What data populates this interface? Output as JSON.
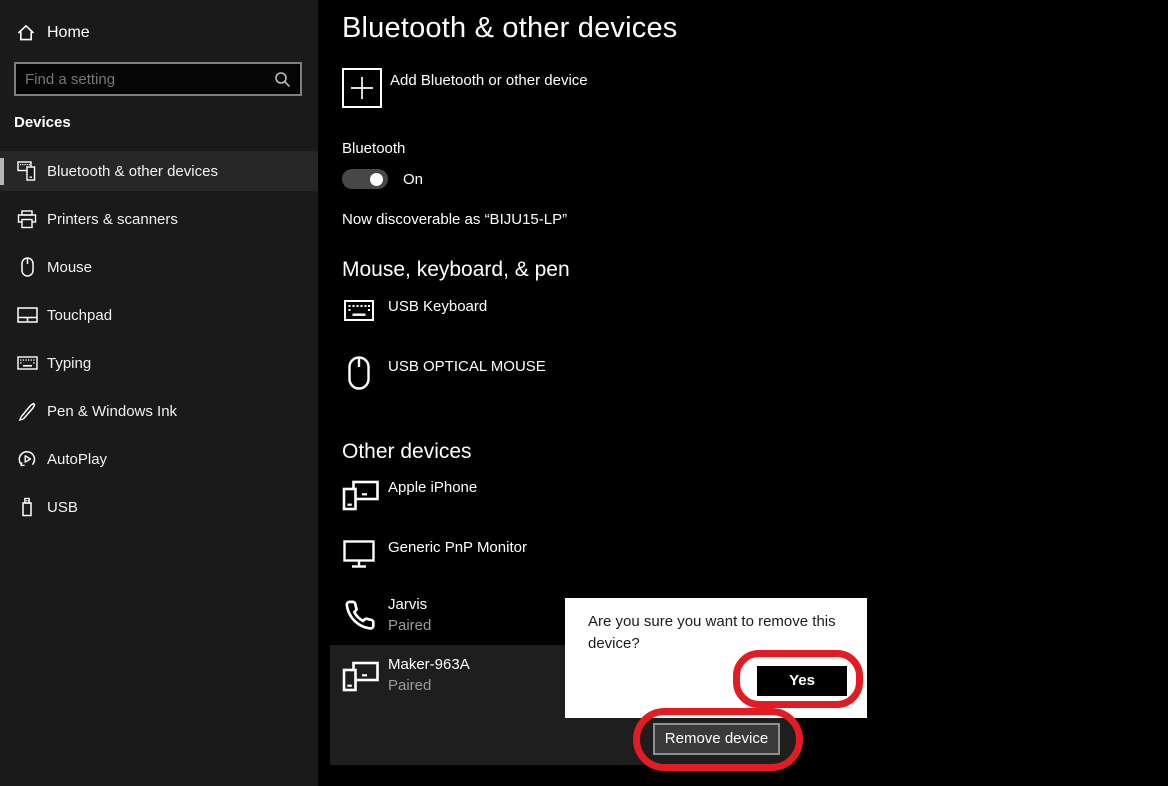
{
  "sidebar": {
    "home_label": "Home",
    "search_placeholder": "Find a setting",
    "section_label": "Devices",
    "items": [
      {
        "label": "Bluetooth & other devices",
        "selected": true
      },
      {
        "label": "Printers & scanners",
        "selected": false
      },
      {
        "label": "Mouse",
        "selected": false
      },
      {
        "label": "Touchpad",
        "selected": false
      },
      {
        "label": "Typing",
        "selected": false
      },
      {
        "label": "Pen & Windows Ink",
        "selected": false
      },
      {
        "label": "AutoPlay",
        "selected": false
      },
      {
        "label": "USB",
        "selected": false
      }
    ]
  },
  "main": {
    "title": "Bluetooth & other devices",
    "add_device_label": "Add Bluetooth or other device",
    "bluetooth": {
      "label": "Bluetooth",
      "state": "On"
    },
    "discoverable_text": "Now discoverable as “BIJU15-LP”",
    "sections": [
      {
        "header": "Mouse, keyboard, & pen",
        "devices": [
          {
            "name": "USB Keyboard"
          },
          {
            "name": "USB OPTICAL MOUSE"
          }
        ]
      },
      {
        "header": "Other devices",
        "devices": [
          {
            "name": "Apple iPhone"
          },
          {
            "name": "Generic PnP Monitor"
          },
          {
            "name": "Jarvis",
            "status": "Paired"
          },
          {
            "name": "Maker-963A",
            "status": "Paired",
            "selected": true
          }
        ]
      }
    ],
    "remove_device_label": "Remove device"
  },
  "dialog": {
    "message": "Are you sure you want to remove this device?",
    "yes_label": "Yes"
  },
  "colors": {
    "annotation_red": "#e31b22",
    "sidebar_bg": "#1a1a1a",
    "main_bg": "#000000",
    "selected_row_bg": "#1e1e1e",
    "dialog_bg": "#ffffff"
  }
}
